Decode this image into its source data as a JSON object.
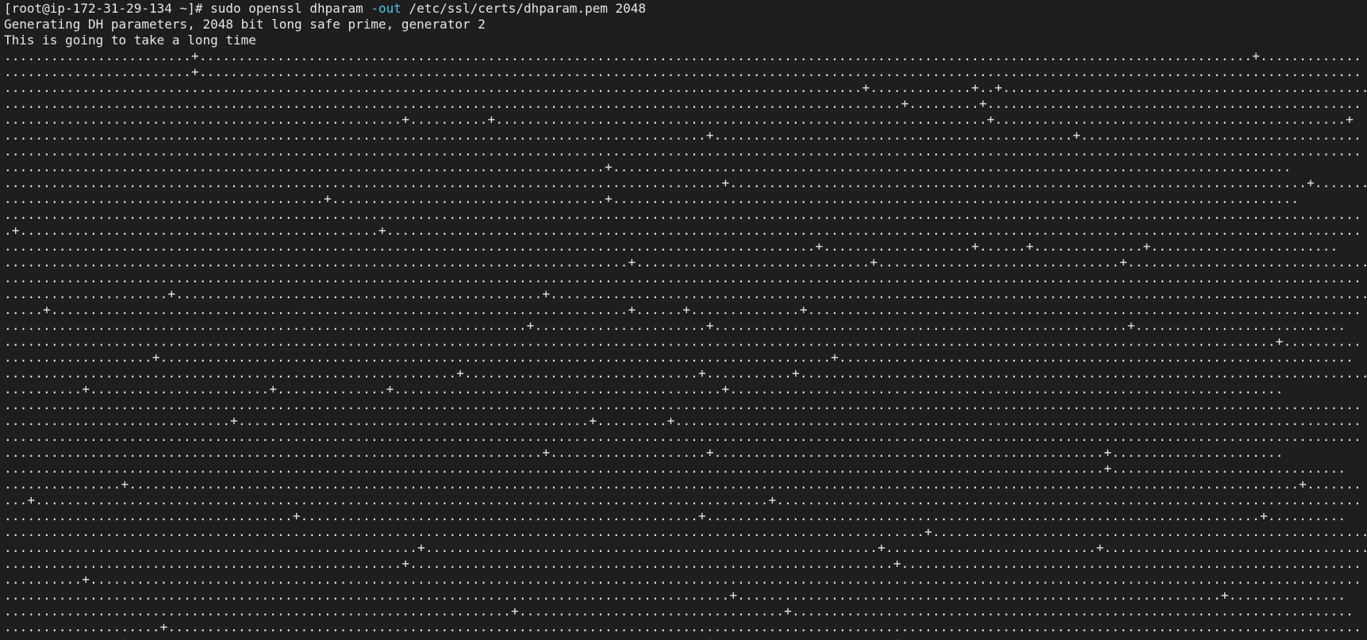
{
  "terminal": {
    "background": "#1e1e1e",
    "foreground": "#e6e6e6",
    "option_color": "#4ec3e6",
    "prompt": {
      "prompt_text": "[root@ip-172-31-29-134 ~]# ",
      "command_pre": "sudo openssl dhparam ",
      "command_option": "-out",
      "command_post": " /etc/ssl/certs/dhparam.pem 2048"
    },
    "output": [
      "Generating DH parameters, 2048 bit long safe prime, generator 2",
      "This is going to take a long time"
    ],
    "progress_lines": [
      "........................+.......................................................................................................................................+.............",
      "........................+.....................................................................................................................................................",
      "..............................................................................................................+.............+..+...............................................",
      "...................................................................................................................+.........+................................................",
      "...................................................+..........+...............................................................+.............................................+",
      "..........................................................................................+..............................................+....................................",
      "..............................................................................................................................................................................",
      ".............................................................................+.......................................................................................",
      "............................................................................................+..........................................................................+.......",
      ".........................................+...................................+........................................................................................",
      "..............................................................................................................................................................................",
      ".+..............................................+.............................................................................................................................",
      "........................................................................................................+...................+......+..............+........................",
      "................................................................................+..............................+...............................+.................................",
      "..............................................................................................................................................................................",
      ".....................+...............................................+.........................................................................................................",
      ".....+..........................................................................+......+..............+.......................................................................",
      "...................................................................+......................+.....................................................+...........................",
      "...................................................................................................................................................................+..........",
      "...................+......................................................................................+..................................................................",
      "..........................................................+..............................+...........+..........................................................................",
      "..........+.......................+..............+..........................................+.......................................................................",
      "..............................................................................................................................................................................",
      ".............................+.............................................+.........+........................................................................................",
      "..............................................................................................................................................................................",
      ".....................................................................+....................+..................................................+......................",
      ".............................................................................................................................................+..............................",
      "...............+......................................................................................................................................................+.......",
      "...+..............................................................................................+...........................................................................",
      ".....................................+...................................................+.......................................................................+..........",
      "......................................................................................................................+........................................................",
      ".....................................................+..........................................................+...........................+...................................",
      "...................................................+..............................................................+...........................................................",
      "..........+...................................................................................................................................................................",
      ".............................................................................................+..............................................................+...............",
      ".................................................................+..................................+........................................................................",
      "....................+.........................................................................................................................................................",
      "...............+..........................................................................+.......................+...........................................................",
      "................................................................................................................................................................................"
    ]
  }
}
